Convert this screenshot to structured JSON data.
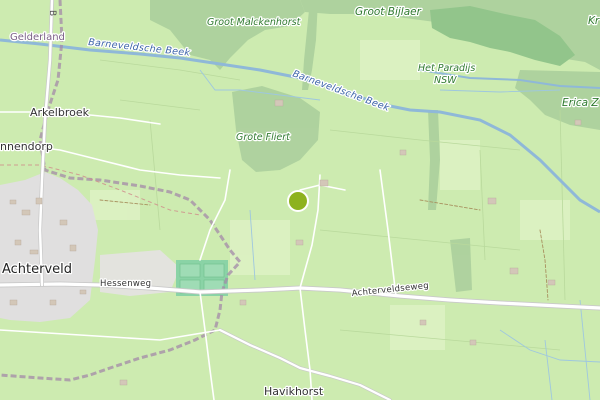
{
  "map": {
    "colors": {
      "farmland": "#cdebb0",
      "forest": "#add19e",
      "forest_dark": "#8fc48a",
      "residential": "#e0dfdf",
      "water": "#aad3df",
      "river": "#8fb8d8",
      "road": "#ffffff",
      "road_casing": "#c9c9c9",
      "boundary": "#a38aa8",
      "marker": "#8db21e"
    },
    "labels": {
      "groot_malckenhorst": "Groot Malckenhorst",
      "groot_bijlaer": "Groot Bijlaer",
      "kr": "Kr",
      "gelderland": "Gelderland",
      "barneveldsche_beek_1": "Barneveldsche Beek",
      "barneveldsche_beek_2": "Barneveldsche Beek",
      "het_paradijs_line1": "Het Paradijs",
      "het_paradijs_line2": "NSW",
      "erica_z": "Erica Z",
      "arkelbroek": "Arkelbroek",
      "nnendorp": "nnendorp",
      "grote_fliert": "Grote Fliert",
      "achterveld": "Achterveld",
      "hessenweg": "Hessenweg",
      "achterveldseweg": "Achterveldseweg",
      "havikhorst": "Havikhorst",
      "road_number": "B"
    },
    "marker": {
      "icon": "location-marker-icon"
    }
  }
}
